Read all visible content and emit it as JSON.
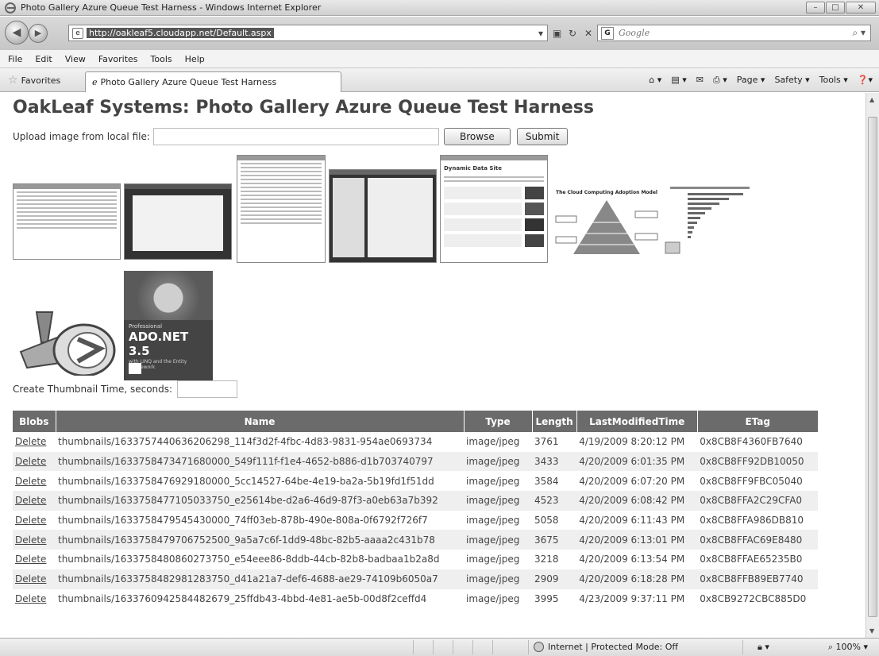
{
  "window": {
    "title": "Photo Gallery Azure Queue Test Harness - Windows Internet Explorer",
    "btn_min": "–",
    "btn_max": "□",
    "btn_close": "✕"
  },
  "address": {
    "url": "http://oakleaf5.cloudapp.net/Default.aspx",
    "search_placeholder": "Google"
  },
  "menu": [
    "File",
    "Edit",
    "View",
    "Favorites",
    "Tools",
    "Help"
  ],
  "favorites": {
    "label": "Favorites",
    "tab_title": "Photo Gallery Azure Queue Test Harness",
    "tools": [
      "Page ▾",
      "Safety ▾",
      "Tools ▾"
    ]
  },
  "page": {
    "title": "OakLeaf Systems: Photo Gallery Azure Queue Test Harness",
    "upload_label": "Upload image from local file:",
    "browse": "Browse",
    "submit": "Submit",
    "time_label": "Create Thumbnail Time, seconds:",
    "time_value": ""
  },
  "table": {
    "headers": [
      "Blobs",
      "Name",
      "Type",
      "Length",
      "LastModifiedTime",
      "ETag"
    ],
    "rows": [
      {
        "action": "Delete",
        "name": "thumbnails/1633757440636206298_114f3d2f-4fbc-4d83-9831-954ae0693734",
        "type": "image/jpeg",
        "length": "3761",
        "modified": "4/19/2009 8:20:12 PM",
        "etag": "0x8CB8F4360FB7640"
      },
      {
        "action": "Delete",
        "name": "thumbnails/1633758473471680000_549f111f-f1e4-4652-b886-d1b703740797",
        "type": "image/jpeg",
        "length": "3433",
        "modified": "4/20/2009 6:01:35 PM",
        "etag": "0x8CB8FF92DB10050"
      },
      {
        "action": "Delete",
        "name": "thumbnails/1633758476929180000_5cc14527-64be-4e19-ba2a-5b19fd1f51dd",
        "type": "image/jpeg",
        "length": "3584",
        "modified": "4/20/2009 6:07:20 PM",
        "etag": "0x8CB8FF9FBC05040"
      },
      {
        "action": "Delete",
        "name": "thumbnails/1633758477105033750_e25614be-d2a6-46d9-87f3-a0eb63a7b392",
        "type": "image/jpeg",
        "length": "4523",
        "modified": "4/20/2009 6:08:42 PM",
        "etag": "0x8CB8FFA2C29CFA0"
      },
      {
        "action": "Delete",
        "name": "thumbnails/1633758479545430000_74ff03eb-878b-490e-808a-0f6792f726f7",
        "type": "image/jpeg",
        "length": "5058",
        "modified": "4/20/2009 6:11:43 PM",
        "etag": "0x8CB8FFA986DB810"
      },
      {
        "action": "Delete",
        "name": "thumbnails/1633758479706752500_9a5a7c6f-1dd9-48bc-82b5-aaaa2c431b78",
        "type": "image/jpeg",
        "length": "3675",
        "modified": "4/20/2009 6:13:01 PM",
        "etag": "0x8CB8FFAC69E8480"
      },
      {
        "action": "Delete",
        "name": "thumbnails/1633758480860273750_e54eee86-8ddb-44cb-82b8-badbaa1b2a8d",
        "type": "image/jpeg",
        "length": "3218",
        "modified": "4/20/2009 6:13:54 PM",
        "etag": "0x8CB8FFAE65235B0"
      },
      {
        "action": "Delete",
        "name": "thumbnails/1633758482981283750_d41a21a7-def6-4688-ae29-74109b6050a7",
        "type": "image/jpeg",
        "length": "2909",
        "modified": "4/20/2009 6:18:28 PM",
        "etag": "0x8CB8FFB89EB7740"
      },
      {
        "action": "Delete",
        "name": "thumbnails/1633760942584482679_25ffdb43-4bbd-4e81-ae5b-00d8f2ceffd4",
        "type": "image/jpeg",
        "length": "3995",
        "modified": "4/23/2009 9:37:11 PM",
        "etag": "0x8CB9272CBC885D0"
      }
    ]
  },
  "status": {
    "zone": "Internet | Protected Mode: Off",
    "zoom": "100%"
  },
  "thumbnails": {
    "pyramid_title": "The Cloud Computing Adoption Model",
    "book_series": "Professional",
    "book_title": "ADO.NET 3.5",
    "book_subtitle": "with LINQ and the Entity Framework",
    "dds_title": "Dynamic Data Site"
  }
}
